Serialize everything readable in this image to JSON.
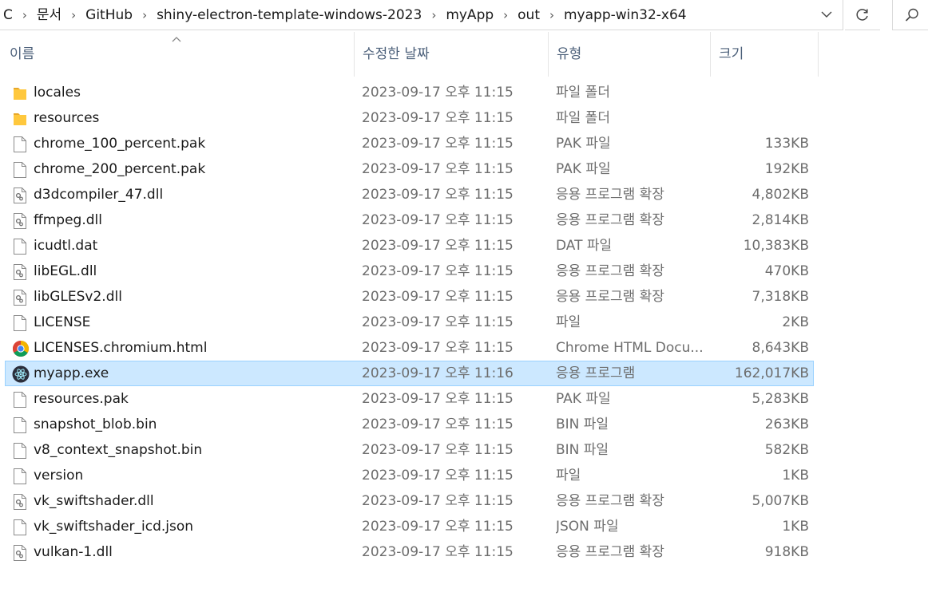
{
  "breadcrumb": [
    "C",
    "문서",
    "GitHub",
    "shiny-electron-template-windows-2023",
    "myApp",
    "out",
    "myapp-win32-x64"
  ],
  "columns": {
    "name": "이름",
    "date": "수정한 날짜",
    "type": "유형",
    "size": "크기"
  },
  "colors": {
    "selection_bg": "#cce8ff",
    "selection_border": "#99d1ff",
    "header_text": "#4c607a",
    "folder": "#ffc83d"
  },
  "files": [
    {
      "name": "locales",
      "date": "2023-09-17 오후 11:15",
      "type": "파일 폴더",
      "size": "",
      "icon": "folder-icon"
    },
    {
      "name": "resources",
      "date": "2023-09-17 오후 11:15",
      "type": "파일 폴더",
      "size": "",
      "icon": "folder-icon"
    },
    {
      "name": "chrome_100_percent.pak",
      "date": "2023-09-17 오후 11:15",
      "type": "PAK 파일",
      "size": "133KB",
      "icon": "file-icon"
    },
    {
      "name": "chrome_200_percent.pak",
      "date": "2023-09-17 오후 11:15",
      "type": "PAK 파일",
      "size": "192KB",
      "icon": "file-icon"
    },
    {
      "name": "d3dcompiler_47.dll",
      "date": "2023-09-17 오후 11:15",
      "type": "응용 프로그램 확장",
      "size": "4,802KB",
      "icon": "dll-icon"
    },
    {
      "name": "ffmpeg.dll",
      "date": "2023-09-17 오후 11:15",
      "type": "응용 프로그램 확장",
      "size": "2,814KB",
      "icon": "dll-icon"
    },
    {
      "name": "icudtl.dat",
      "date": "2023-09-17 오후 11:15",
      "type": "DAT 파일",
      "size": "10,383KB",
      "icon": "file-icon"
    },
    {
      "name": "libEGL.dll",
      "date": "2023-09-17 오후 11:15",
      "type": "응용 프로그램 확장",
      "size": "470KB",
      "icon": "dll-icon"
    },
    {
      "name": "libGLESv2.dll",
      "date": "2023-09-17 오후 11:15",
      "type": "응용 프로그램 확장",
      "size": "7,318KB",
      "icon": "dll-icon"
    },
    {
      "name": "LICENSE",
      "date": "2023-09-17 오후 11:15",
      "type": "파일",
      "size": "2KB",
      "icon": "file-icon"
    },
    {
      "name": "LICENSES.chromium.html",
      "date": "2023-09-17 오후 11:15",
      "type": "Chrome HTML Docu...",
      "size": "8,643KB",
      "icon": "chrome-icon"
    },
    {
      "name": "myapp.exe",
      "date": "2023-09-17 오후 11:16",
      "type": "응용 프로그램",
      "size": "162,017KB",
      "icon": "electron-icon",
      "selected": true
    },
    {
      "name": "resources.pak",
      "date": "2023-09-17 오후 11:15",
      "type": "PAK 파일",
      "size": "5,283KB",
      "icon": "file-icon"
    },
    {
      "name": "snapshot_blob.bin",
      "date": "2023-09-17 오후 11:15",
      "type": "BIN 파일",
      "size": "263KB",
      "icon": "file-icon"
    },
    {
      "name": "v8_context_snapshot.bin",
      "date": "2023-09-17 오후 11:15",
      "type": "BIN 파일",
      "size": "582KB",
      "icon": "file-icon"
    },
    {
      "name": "version",
      "date": "2023-09-17 오후 11:15",
      "type": "파일",
      "size": "1KB",
      "icon": "file-icon"
    },
    {
      "name": "vk_swiftshader.dll",
      "date": "2023-09-17 오후 11:15",
      "type": "응용 프로그램 확장",
      "size": "5,007KB",
      "icon": "dll-icon"
    },
    {
      "name": "vk_swiftshader_icd.json",
      "date": "2023-09-17 오후 11:15",
      "type": "JSON 파일",
      "size": "1KB",
      "icon": "file-icon"
    },
    {
      "name": "vulkan-1.dll",
      "date": "2023-09-17 오후 11:15",
      "type": "응용 프로그램 확장",
      "size": "918KB",
      "icon": "dll-icon"
    }
  ]
}
